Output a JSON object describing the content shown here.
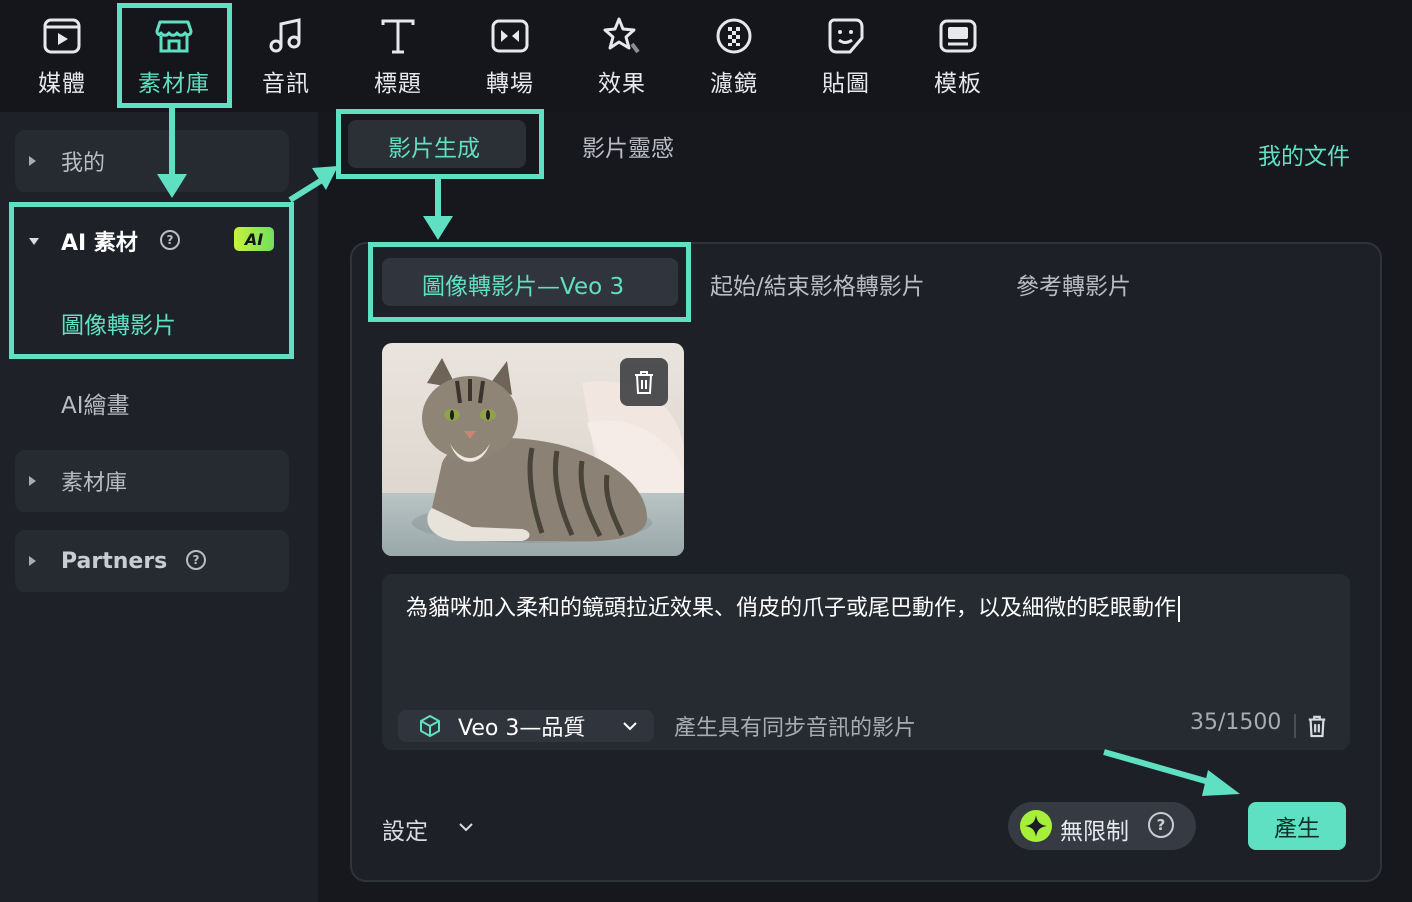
{
  "toolbar": {
    "items": [
      {
        "label": "媒體",
        "icon": "media-icon"
      },
      {
        "label": "素材庫",
        "icon": "store-icon"
      },
      {
        "label": "音訊",
        "icon": "music-note-icon"
      },
      {
        "label": "標題",
        "icon": "text-t-icon"
      },
      {
        "label": "轉場",
        "icon": "transition-icon"
      },
      {
        "label": "效果",
        "icon": "effects-star-icon"
      },
      {
        "label": "濾鏡",
        "icon": "filter-icon"
      },
      {
        "label": "貼圖",
        "icon": "sticker-icon"
      },
      {
        "label": "模板",
        "icon": "template-icon"
      }
    ],
    "active_index": 1
  },
  "sidebar": {
    "mine": "我的",
    "ai_assets": "AI 素材",
    "ai_badge": "AI",
    "image_to_video": "圖像轉影片",
    "ai_painting": "AI繪畫",
    "library": "素材庫",
    "partners": "Partners"
  },
  "main": {
    "tabs": [
      "影片生成",
      "影片靈感"
    ],
    "my_files": "我的文件",
    "subtabs": [
      "圖像轉影片—Veo 3",
      "起始/結束影格轉影片",
      "參考轉影片"
    ],
    "prompt": "為貓咪加入柔和的鏡頭拉近效果、俏皮的爪子或尾巴動作，以及細微的眨眼動作",
    "model": "Veo 3—品質",
    "audio_hint": "產生具有同步音訊的影片",
    "char_count": "35/1500",
    "settings": "設定",
    "unlimited": "無限制",
    "generate": "產生"
  },
  "colors": {
    "accent": "#5fe0c3",
    "toolbar_bg": "#14161b",
    "panel_bg": "#1d2026",
    "badge_green": "#c8f23c"
  }
}
